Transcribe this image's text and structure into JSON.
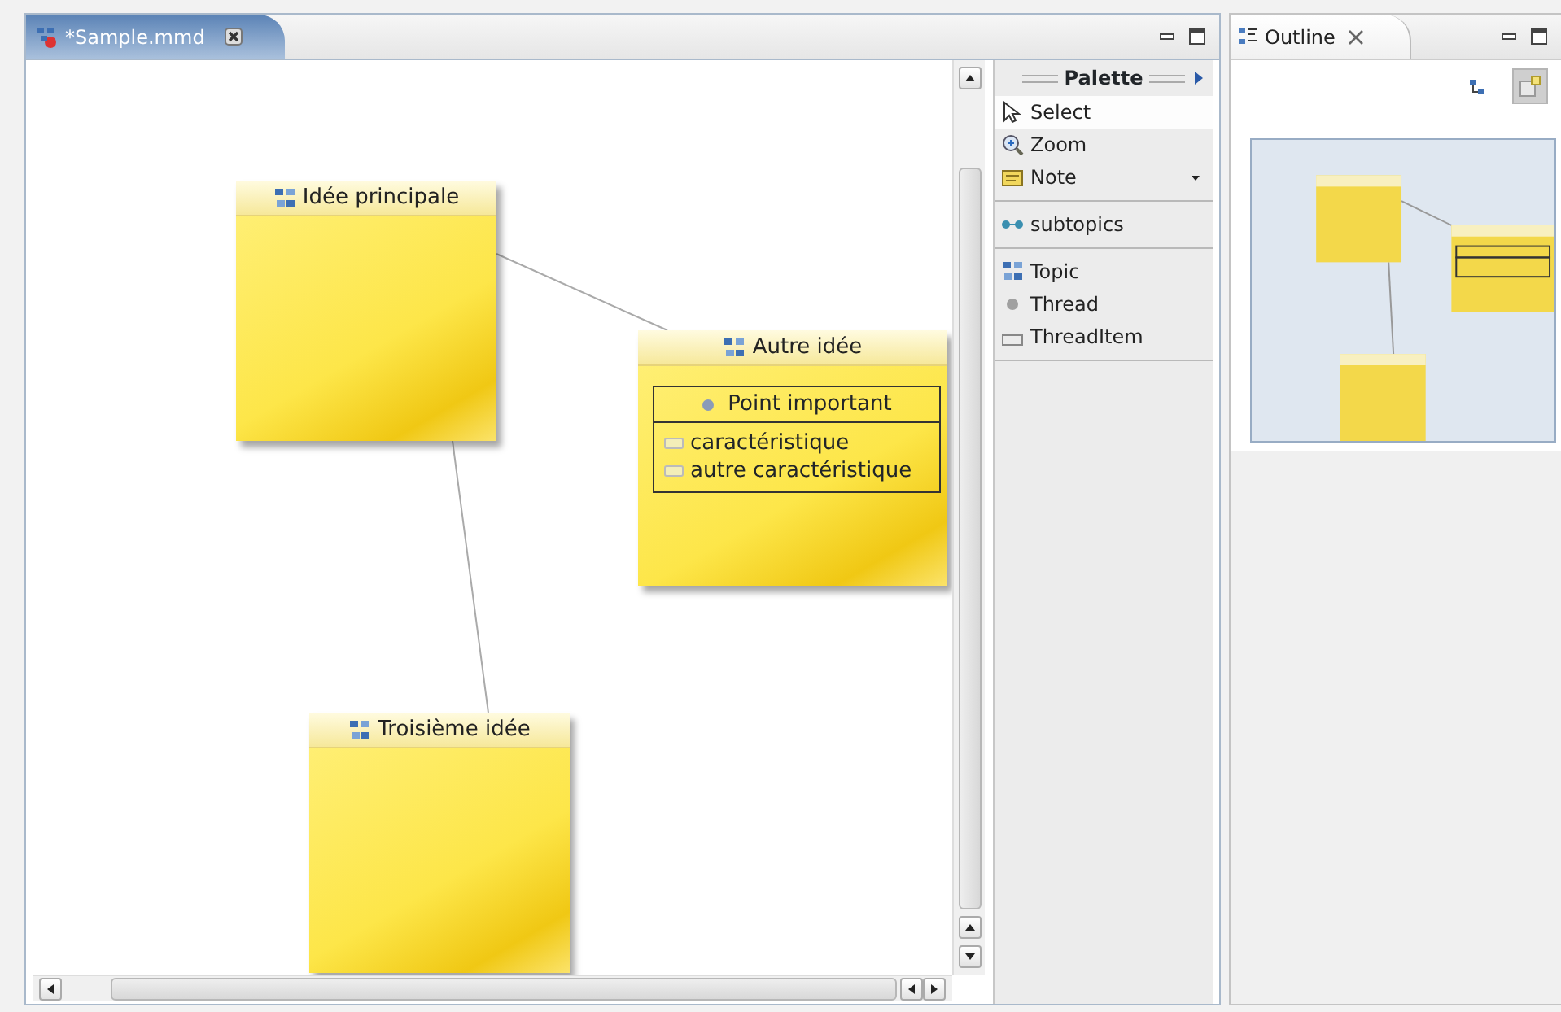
{
  "editor": {
    "tab": {
      "title": "*Sample.mmd",
      "selected": true
    }
  },
  "diagram": {
    "topics": [
      {
        "title": "Idée principale"
      },
      {
        "title": "Autre idée",
        "threads": [
          {
            "title": "Point important",
            "items": [
              "caractéristique",
              "autre caractéristique"
            ]
          }
        ]
      },
      {
        "title": "Troisième idée"
      }
    ]
  },
  "palette": {
    "title": "Palette",
    "groups": [
      {
        "items": [
          {
            "label": "Select",
            "kind": "select",
            "selected": true,
            "dropdown": false
          },
          {
            "label": "Zoom",
            "kind": "zoom",
            "selected": false,
            "dropdown": false
          },
          {
            "label": "Note",
            "kind": "note",
            "selected": false,
            "dropdown": true
          }
        ]
      },
      {
        "items": [
          {
            "label": "subtopics",
            "kind": "link",
            "selected": false,
            "dropdown": false
          }
        ]
      },
      {
        "items": [
          {
            "label": "Topic",
            "kind": "topic",
            "selected": false,
            "dropdown": false
          },
          {
            "label": "Thread",
            "kind": "thread",
            "selected": false,
            "dropdown": false
          },
          {
            "label": "ThreadItem",
            "kind": "threaditem",
            "selected": false,
            "dropdown": false
          }
        ]
      }
    ]
  },
  "outline": {
    "tab": {
      "title": "Outline",
      "selected": true
    }
  }
}
